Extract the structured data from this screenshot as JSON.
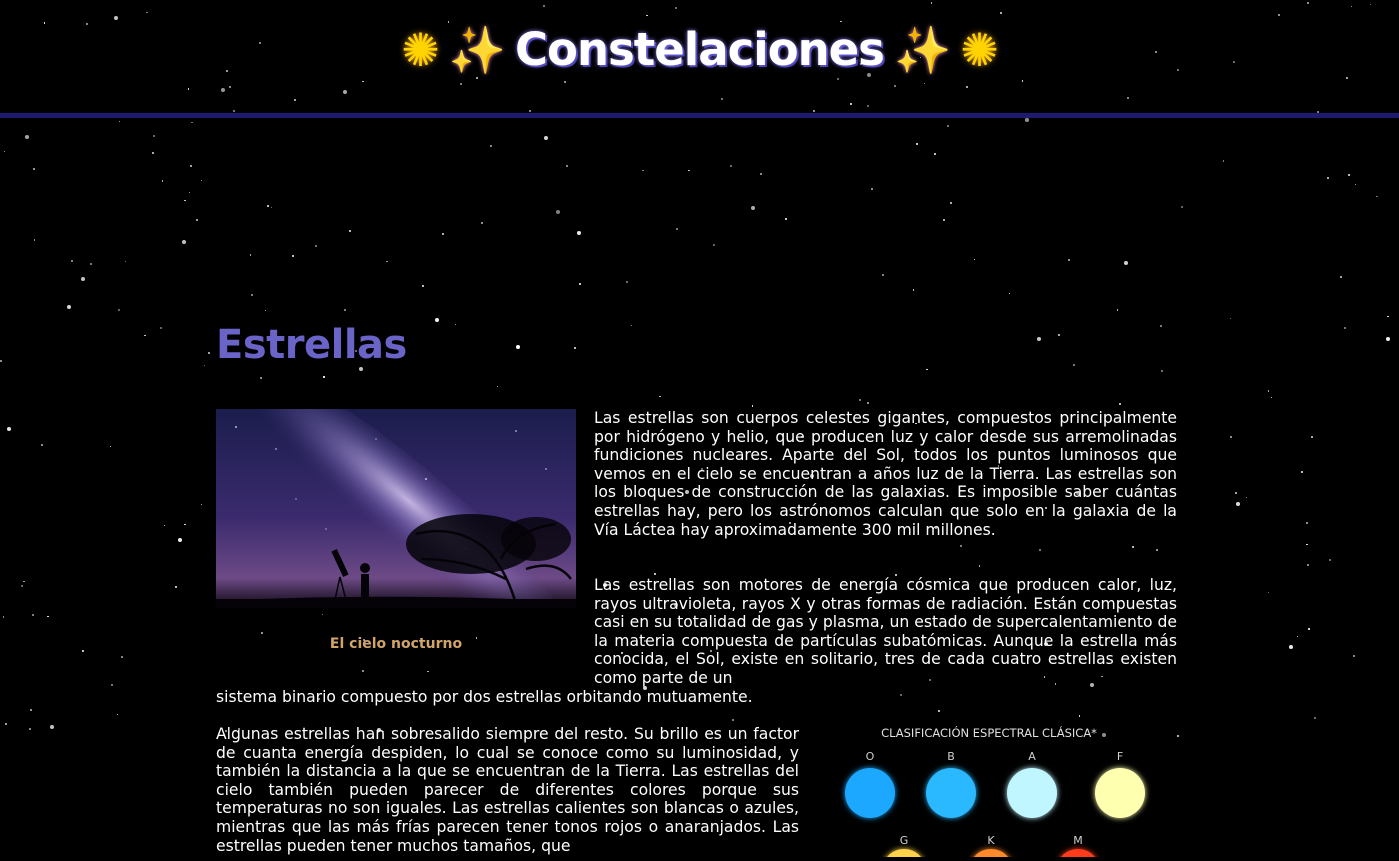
{
  "header": {
    "title": "Constelaciones",
    "left_icons": [
      "sparkler-icon",
      "sparkles-icon"
    ],
    "right_icons": [
      "sparkles-icon",
      "sparkler-icon"
    ]
  },
  "section": {
    "heading": "Estrellas"
  },
  "figure": {
    "caption": "El cielo nocturno"
  },
  "paragraphs": {
    "p1": "Las estrellas son cuerpos celestes gigantes, compuestos principalmente por hidrógeno y helio, que producen luz y calor desde sus arremolinadas fundiciones nucleares. Aparte del Sol, todos los puntos luminosos que vemos en el cielo se encuentran a años luz de la Tierra. Las estrellas son los bloques de construcción de las galaxias. Es imposible saber cuántas estrellas hay, pero los astrónomos calculan que solo en la galaxia de la Vía Láctea hay aproximadamente 300 mil millones.",
    "p2": "Las estrellas son motores de energía cósmica que producen calor, luz, rayos ultravioleta, rayos X y otras formas de radiación. Están compuestas casi en su totalidad de gas y plasma, un estado de supercalentamiento de la materia compuesta de partículas subatómicas. Aunque la estrella más conocida, el Sol, existe en solitario, tres de cada cuatro estrellas existen como parte de un",
    "p2_tail": "sistema binario compuesto por dos estrellas orbitando mutuamente.",
    "p3": "Algunas estrellas han sobresalido siempre del resto. Su brillo es un factor de cuanta energía despiden, lo cual se conoce como su luminosidad, y también la distancia a la que se encuentran de la Tierra. Las estrellas del cielo también pueden parecer de diferentes colores porque sus temperaturas no son iguales. Las estrellas calientes son blancas o azules, mientras que las más frías parecen tener tonos rojos o anaranjados. Las estrellas pueden tener muchos tamaños, que"
  },
  "spectral_chart": {
    "title": "CLASIFICACIÓN  ESPECTRAL CLÁSICA*",
    "classes_top": [
      "O",
      "B",
      "A",
      "F"
    ],
    "classes_bottom": [
      "G",
      "K",
      "M"
    ],
    "colors_top": [
      "#1fa8ff",
      "#29b8ff",
      "#bff6ff",
      "#ffffb0"
    ],
    "colors_bottom": [
      "#ffd34a",
      "#ff8a2a",
      "#ff3b1f"
    ]
  }
}
